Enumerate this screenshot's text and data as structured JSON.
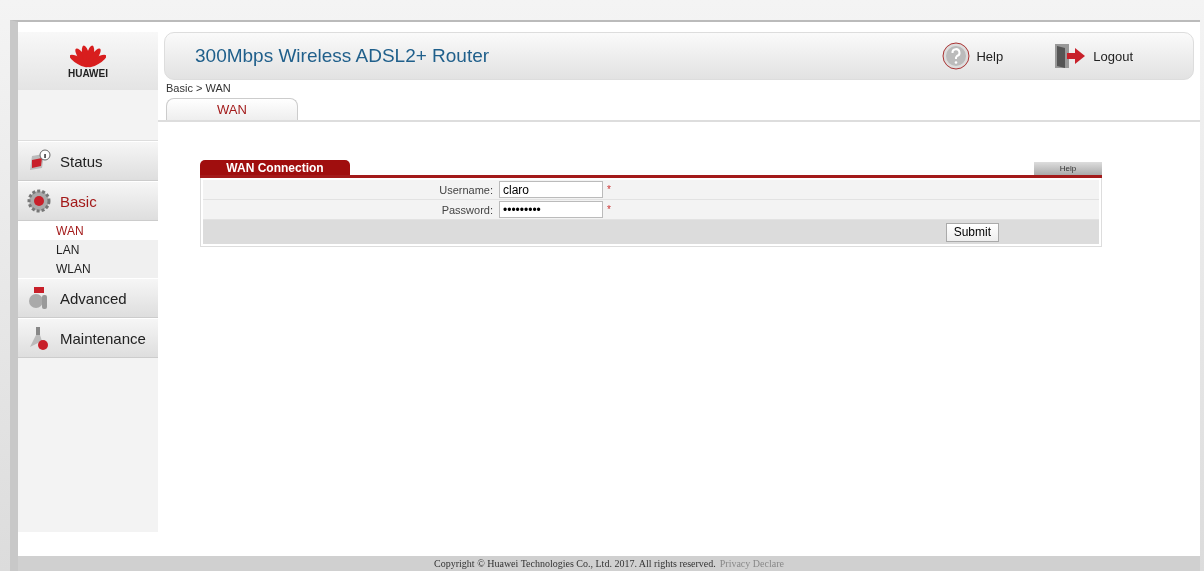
{
  "logo": {
    "text": "HUAWEI"
  },
  "header": {
    "title": "300Mbps Wireless ADSL2+ Router",
    "help": "Help",
    "logout": "Logout"
  },
  "sidebar": {
    "items": [
      {
        "label": "Status",
        "kind": "status",
        "selected": false
      },
      {
        "label": "Basic",
        "kind": "basic",
        "selected": true,
        "children": [
          {
            "label": "WAN",
            "selected": true
          },
          {
            "label": "LAN",
            "selected": false
          },
          {
            "label": "WLAN",
            "selected": false
          }
        ]
      },
      {
        "label": "Advanced",
        "kind": "advanced",
        "selected": false
      },
      {
        "label": "Maintenance",
        "kind": "maintenance",
        "selected": false
      }
    ]
  },
  "breadcrumb": "Basic > WAN",
  "tabs": [
    {
      "label": "WAN",
      "selected": true
    }
  ],
  "panel": {
    "title": "WAN Connection",
    "help": "Help",
    "fields": [
      {
        "label": "Username:",
        "value": "claro",
        "required": "*"
      },
      {
        "label": "Password:",
        "value": "•••••••••",
        "required": "*"
      }
    ],
    "submit": "Submit"
  },
  "footer": {
    "text": "Copyright © Huawei Technologies Co., Ltd. 2017. All rights reserved.",
    "link": "Privacy Declare"
  }
}
